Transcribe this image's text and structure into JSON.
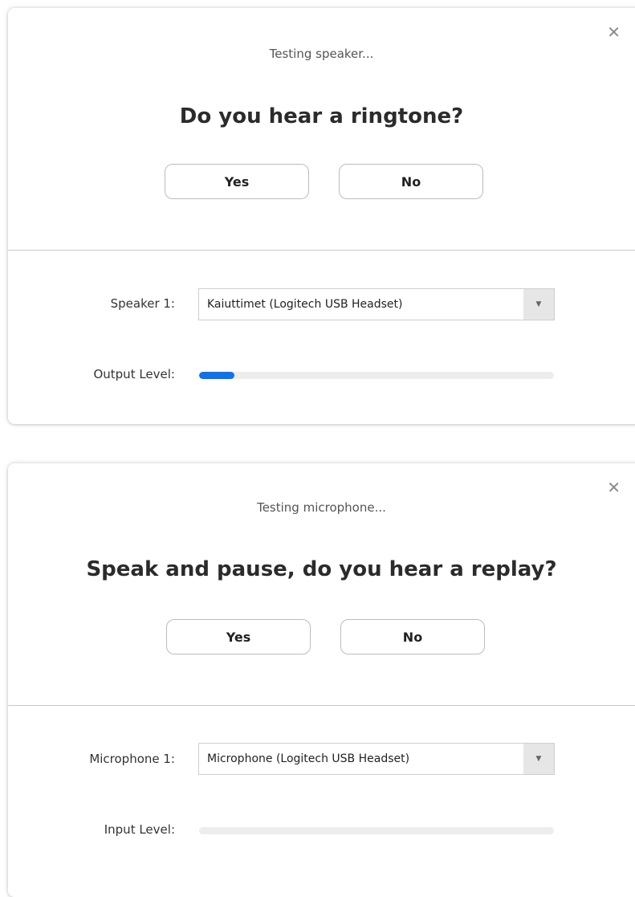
{
  "speaker_test": {
    "status": "Testing speaker...",
    "question": "Do you hear a ringtone?",
    "yes_label": "Yes",
    "no_label": "No",
    "device_label": "Speaker 1:",
    "device_value": "Kaiuttimet (Logitech USB Headset)",
    "level_label": "Output Level:",
    "level_fraction": 0.1,
    "close_icon": "close-icon"
  },
  "mic_test": {
    "status": "Testing microphone...",
    "question": "Speak and pause, do you hear a replay?",
    "yes_label": "Yes",
    "no_label": "No",
    "device_label": "Microphone 1:",
    "device_value": "Microphone (Logitech USB Headset)",
    "level_label": "Input Level:",
    "level_fraction": 0,
    "close_icon": "close-icon"
  },
  "colors": {
    "level_fill": "#0e72ed",
    "level_track": "#ededed"
  }
}
